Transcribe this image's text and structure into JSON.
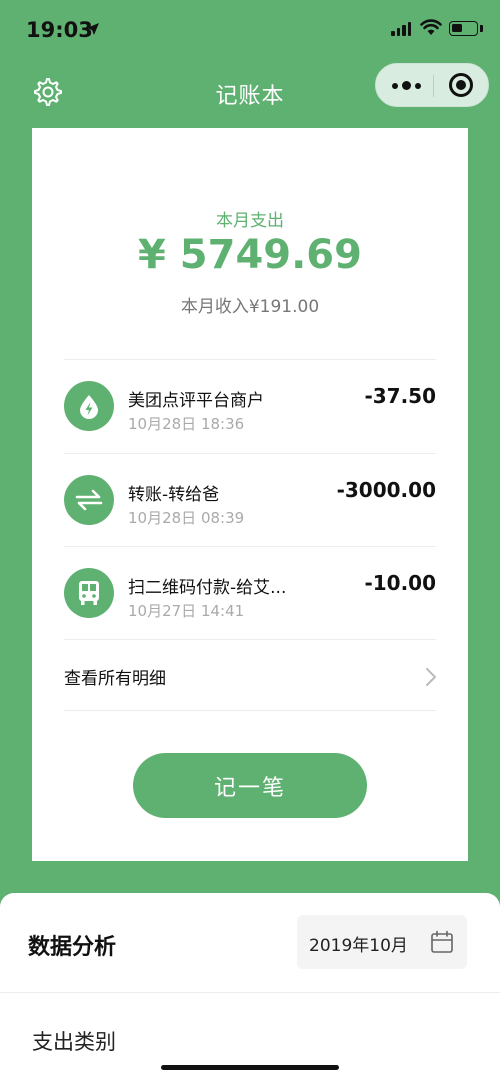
{
  "status_bar": {
    "time": "19:03"
  },
  "nav": {
    "title": "记账本"
  },
  "summary": {
    "label": "本月支出",
    "amount": "¥ 5749.69",
    "income": "本月收入¥191.00"
  },
  "transactions": [
    {
      "title": "美团点评平台商户",
      "date": "10月28日 18:36",
      "amount": "-37.50",
      "icon": "bolt-drop-icon"
    },
    {
      "title": "转账-转给爸",
      "date": "10月28日 08:39",
      "amount": "-3000.00",
      "icon": "transfer-arrows-icon"
    },
    {
      "title": "扫二维码付款-给艾...",
      "date": "10月27日 14:41",
      "amount": "-10.00",
      "icon": "bus-icon"
    }
  ],
  "view_all_label": "查看所有明细",
  "record_button_label": "记一笔",
  "analysis": {
    "title": "数据分析",
    "date_value": "2019年10月",
    "category_label": "支出类别"
  },
  "colors": {
    "accent": "#5fb171",
    "background": "#5fb171"
  }
}
